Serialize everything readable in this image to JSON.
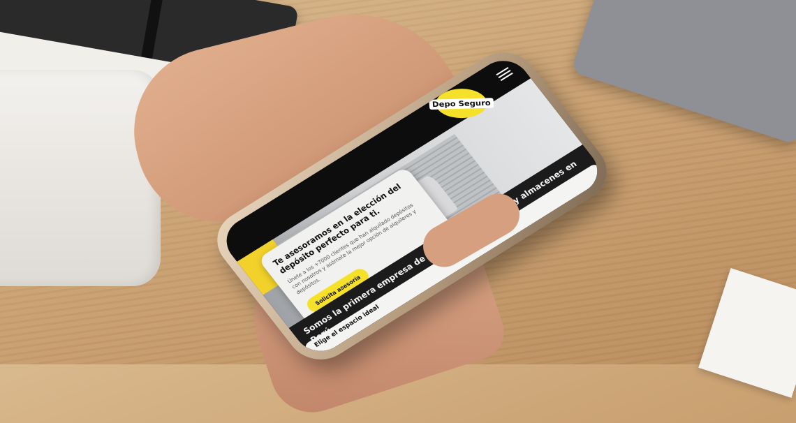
{
  "brand": {
    "logo_text": "Depo Seguro",
    "accent": "#f5e12a"
  },
  "header": {
    "menu_icon": "menu-icon"
  },
  "hero_card": {
    "title": "Te asesoramos en la elección del depósito perfecto para ti.",
    "body": "Únete a los +7000 clientes que han alquilado depósitos con nosotros y asómate la mejor opción de alquileres y depósitos.",
    "cta_label": "Solicita asesoría"
  },
  "carousel": {
    "total": 3,
    "active": 1
  },
  "section": {
    "claim": "Somos la primera empresa de alquiler de depósitos y almacenes en Perú.",
    "tab_label": "Elige el espacio ideal"
  }
}
